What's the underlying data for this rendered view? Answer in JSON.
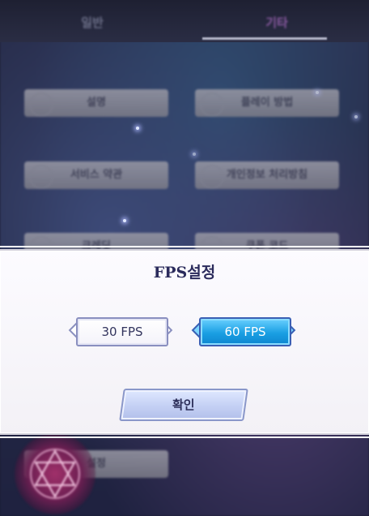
{
  "tabs": [
    {
      "label": "일반",
      "active": false
    },
    {
      "label": "기타",
      "active": true
    }
  ],
  "menu": {
    "items": [
      {
        "label": "설명"
      },
      {
        "label": "플레이 방법"
      },
      {
        "label": "서비스 약관"
      },
      {
        "label": "개인정보 처리방침"
      },
      {
        "label": "크레딧"
      },
      {
        "label": "쿠폰 코드"
      },
      {
        "label": "설정"
      }
    ]
  },
  "dialog": {
    "title": "FPS설정",
    "options": [
      {
        "label": "30 FPS",
        "selected": false
      },
      {
        "label": "60 FPS",
        "selected": true
      }
    ],
    "confirm_label": "확인"
  },
  "colors": {
    "selected": "#1a9fe3",
    "unselected": "#ffffff",
    "title": "#2b2b5c"
  }
}
